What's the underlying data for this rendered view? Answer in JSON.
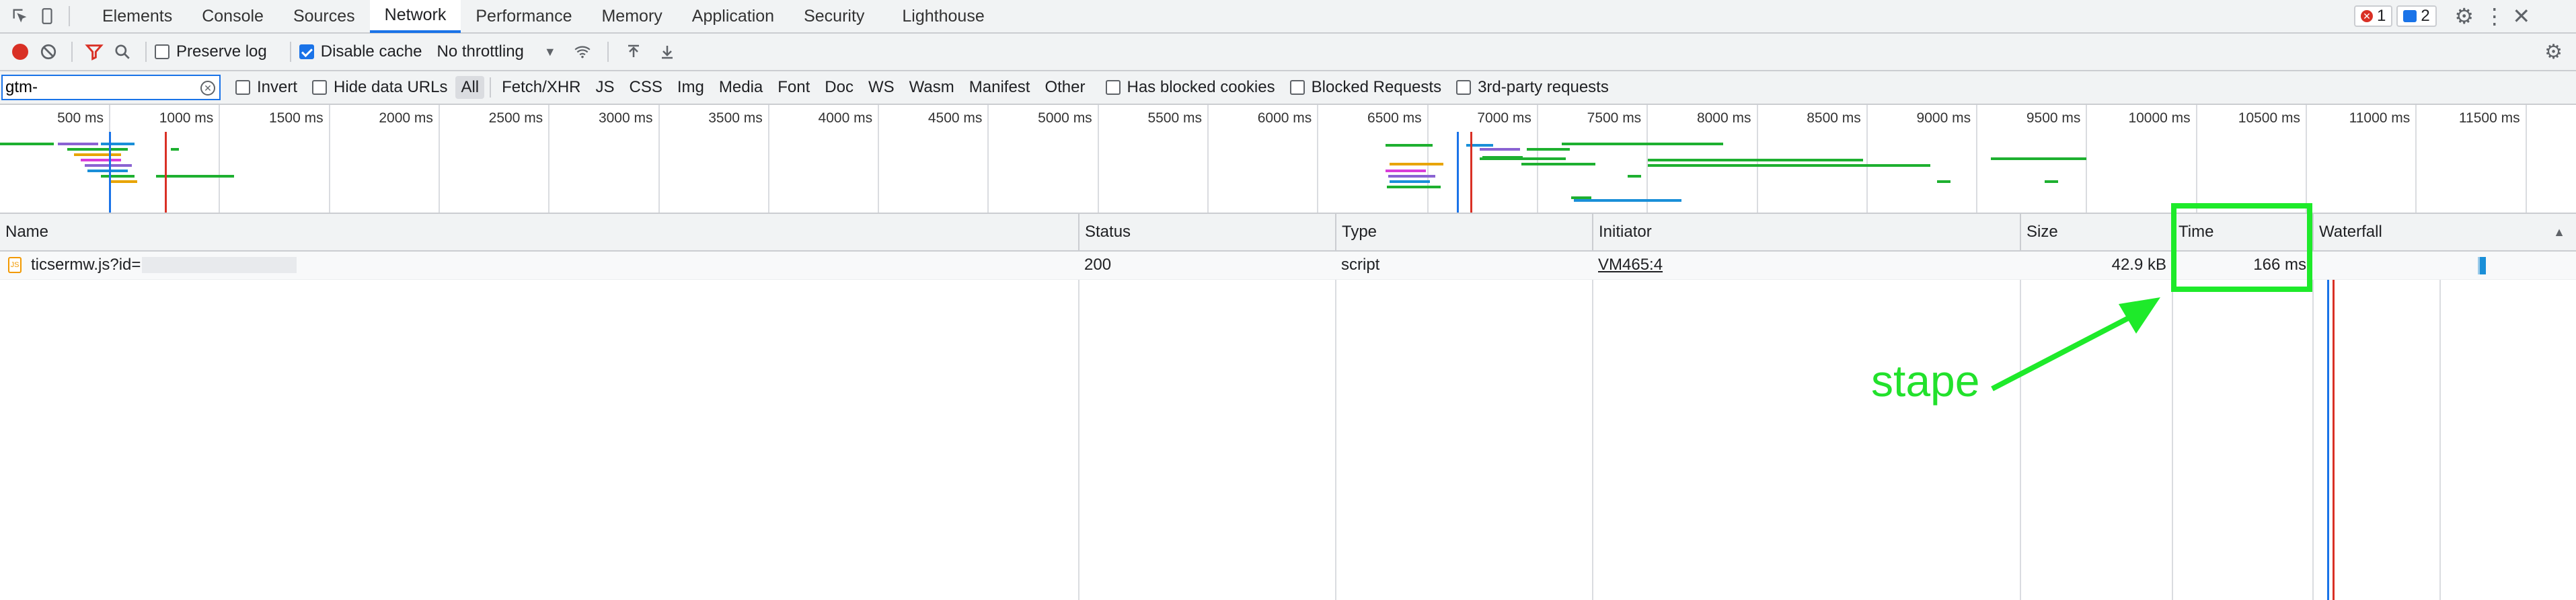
{
  "tabs": [
    "Elements",
    "Console",
    "Sources",
    "Network",
    "Performance",
    "Memory",
    "Application",
    "Security",
    "Lighthouse"
  ],
  "active_tab": "Network",
  "badges": {
    "errors": "1",
    "messages": "2"
  },
  "toolbar": {
    "preserve_log": "Preserve log",
    "disable_cache": "Disable cache",
    "throttling": "No throttling"
  },
  "filter": {
    "value": "gtm-",
    "invert": "Invert",
    "hide_data_urls": "Hide data URLs",
    "types": [
      "All",
      "Fetch/XHR",
      "JS",
      "CSS",
      "Img",
      "Media",
      "Font",
      "Doc",
      "WS",
      "Wasm",
      "Manifest",
      "Other"
    ],
    "selected_type": "All",
    "has_blocked_cookies": "Has blocked cookies",
    "blocked_requests": "Blocked Requests",
    "third_party": "3rd-party requests"
  },
  "overview_ticks": [
    "500 ms",
    "1000 ms",
    "1500 ms",
    "2000 ms",
    "2500 ms",
    "3000 ms",
    "3500 ms",
    "4000 ms",
    "4500 ms",
    "5000 ms",
    "5500 ms",
    "6000 ms",
    "6500 ms",
    "7000 ms",
    "7500 ms",
    "8000 ms",
    "8500 ms",
    "9000 ms",
    "9500 ms",
    "10000 ms",
    "10500 ms",
    "11000 ms",
    "11500 ms"
  ],
  "columns": [
    "Name",
    "Status",
    "Type",
    "Initiator",
    "Size",
    "Time",
    "Waterfall"
  ],
  "rows": [
    {
      "name": "ticsermw.js?id=",
      "status": "200",
      "type": "script",
      "initiator": "VM465:4",
      "size": "42.9 kB",
      "time": "166 ms"
    }
  ],
  "annotation": "stape",
  "colors": {
    "accent": "#1a73e8",
    "highlight": "#1eea2a",
    "record": "#d93025"
  }
}
